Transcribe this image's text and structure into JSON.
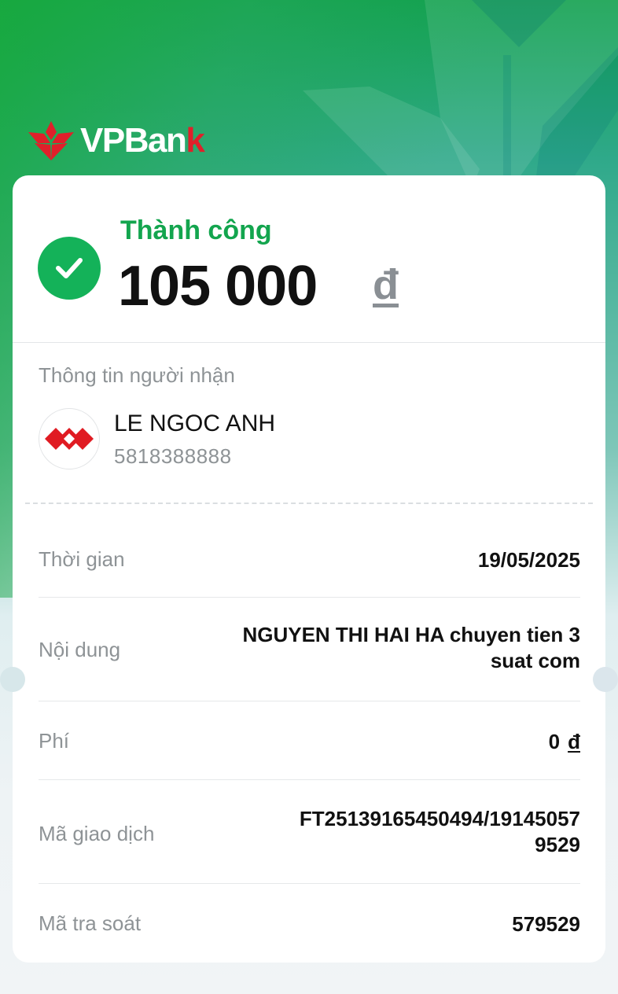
{
  "brand": {
    "name_main": "VPBan",
    "name_last": "k",
    "logo_color": "#e0202a"
  },
  "status": {
    "label": "Thành công",
    "color": "#13a54e",
    "icon": "check-circle-icon"
  },
  "amount": {
    "value": "105 000",
    "currency": "đ"
  },
  "recipient": {
    "section_title": "Thông tin người nhận",
    "name": "LE NGOC ANH",
    "account": "5818388888",
    "bank_icon": "techcombank-logo-icon"
  },
  "details": {
    "time": {
      "label": "Thời gian",
      "value": "19/05/2025"
    },
    "content": {
      "label": "Nội dung",
      "line1": "NGUYEN THI HAI HA chuyen tien 3",
      "line2": "suat com"
    },
    "fee": {
      "label": "Phí",
      "value": "0",
      "currency": "đ"
    },
    "transaction_id": {
      "label": "Mã giao dịch",
      "line1": "FT25139165450494/19145057",
      "line2": "9529"
    },
    "trace": {
      "label": "Mã tra soát",
      "value": "579529"
    }
  }
}
